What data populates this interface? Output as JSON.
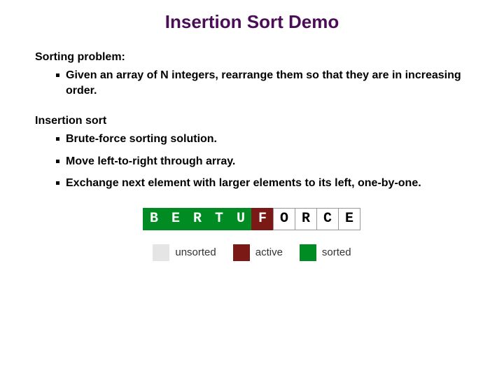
{
  "title": "Insertion Sort Demo",
  "section1": {
    "heading": "Sorting problem:",
    "bullet1": "Given an array of N integers, rearrange them so that they are in increasing order."
  },
  "section2": {
    "heading": "Insertion sort",
    "bullet1": "Brute-force sorting solution.",
    "bullet2": "Move left-to-right through array.",
    "bullet3": "Exchange next element with larger elements to its left, one-by-one."
  },
  "array": {
    "c0": "B",
    "c1": "E",
    "c2": "R",
    "c3": "T",
    "c4": "U",
    "c5": "F",
    "c6": "O",
    "c7": "R",
    "c8": "C",
    "c9": "E"
  },
  "legend": {
    "unsorted": "unsorted",
    "active": "active",
    "sorted": "sorted"
  }
}
